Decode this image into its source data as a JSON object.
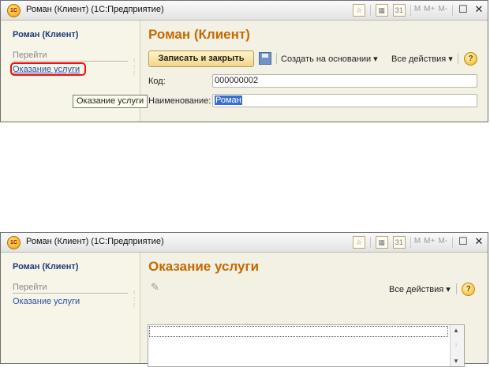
{
  "window1": {
    "title": "Роман (Клиент)  (1С:Предприятие)",
    "logo": "1С",
    "toolbar": {
      "mem": [
        "M",
        "M+",
        "M-"
      ],
      "calendar": "31"
    },
    "sidebar": {
      "title": "Роман (Клиент)",
      "section": "Перейти",
      "link": "Оказание услуги"
    },
    "header": "Роман (Клиент)",
    "buttons": {
      "save_close": "Записать и закрыть",
      "create_based": "Создать на основании ▾",
      "all_actions": "Все действия ▾",
      "help": "?"
    },
    "fields": {
      "code_label": "Код:",
      "code_value": "000000002",
      "name_label": "Наименование:",
      "name_value": "Роман"
    },
    "tooltip": "Оказание услуги"
  },
  "window2": {
    "title": "Роман (Клиент)  (1С:Предприятие)",
    "logo": "1С",
    "toolbar": {
      "mem": [
        "M",
        "M+",
        "M-"
      ],
      "calendar": "31"
    },
    "sidebar": {
      "title": "Роман (Клиент)",
      "section": "Перейти",
      "link": "Оказание услуги"
    },
    "header": "Оказание услуги",
    "buttons": {
      "all_actions": "Все действия ▾",
      "help": "?"
    }
  },
  "accent": {
    "header_orange": "#c66a00",
    "link_blue": "#2a4fa8",
    "highlight_red": "#ee1111"
  }
}
